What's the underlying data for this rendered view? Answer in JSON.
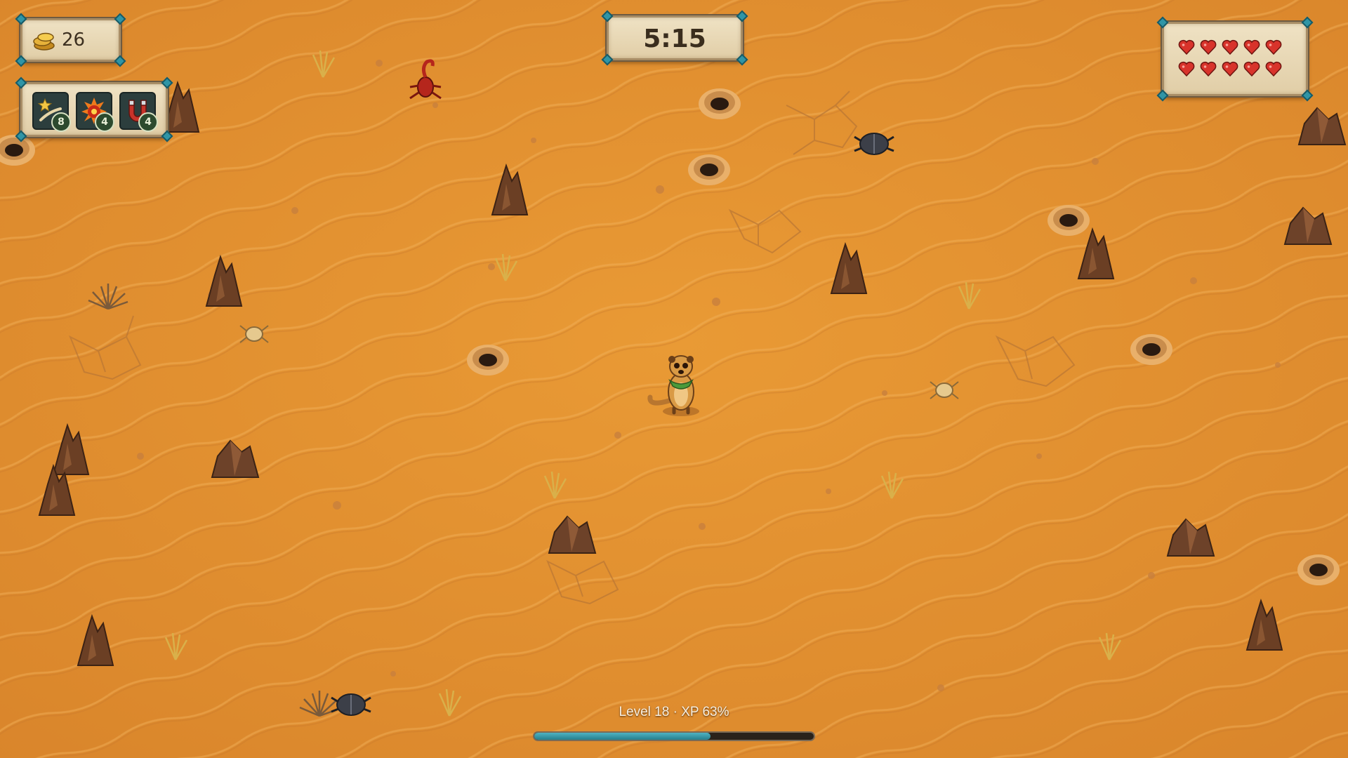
{
  "hud": {
    "coins": {
      "icon": "gold-coins-icon",
      "value": "26"
    },
    "timer": {
      "value": "5:15"
    },
    "hearts": {
      "icon": "heart-icon",
      "count": 10,
      "color": "#d8332b"
    },
    "powerups": [
      {
        "name": "shooting-star",
        "icon": "shooting-star-icon",
        "count": "8"
      },
      {
        "name": "fire-bomb",
        "icon": "fire-bomb-icon",
        "count": "4"
      },
      {
        "name": "magnet",
        "icon": "magnet-icon",
        "count": "4"
      }
    ],
    "xp": {
      "label": "Level 18 · XP 63%",
      "progress": 0.63,
      "color": "#3a9aa8"
    }
  },
  "world": {
    "terrain": "desert-sand",
    "sand_color": "#e2912f",
    "player": "meerkat-player",
    "enemies": [
      "red-scorpion",
      "dark-beetle",
      "sand-spider",
      "sand-spider",
      "dark-beetle"
    ]
  }
}
